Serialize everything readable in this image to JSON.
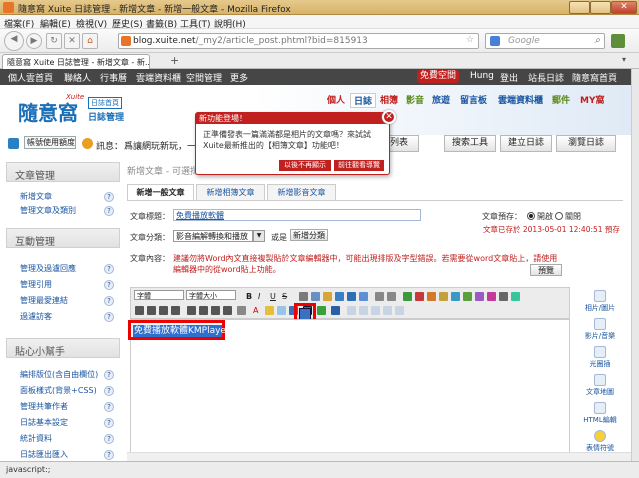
{
  "window": {
    "title": "隨意窩 Xuite 日誌管理 - 新增文章 - 新增一般文章 - Mozilla Firefox",
    "minimize": "",
    "maximize": "",
    "close": "✕"
  },
  "menu": [
    "檔案(F)",
    "編輯(E)",
    "檢視(V)",
    "歷史(S)",
    "書籤(B)",
    "工具(T)",
    "說明(H)"
  ],
  "nav": {
    "url_host": "blog.xuite.net",
    "url_path": "/_my2/article_post.phtml?bid=815913",
    "search_placeholder": "Google"
  },
  "browser_tab": {
    "label": "隨意窩 Xuite 日誌管理 - 新增文章 - 新...",
    "new_tab": "+"
  },
  "site_nav": {
    "items": [
      "個人雲首頁",
      "聯絡人",
      "行事曆",
      "雲端資料櫃",
      "空間管理",
      "更多"
    ],
    "free_space": "免費空間",
    "user": "Hung",
    "links": [
      "登出",
      "站長日誌",
      "隨意窩首頁"
    ]
  },
  "header": {
    "logo": "隨意窩",
    "logo_small": "Xuite",
    "home_badge": "日誌首頁",
    "product": "日誌管理",
    "tabs": [
      "個人",
      "日誌",
      "相簿",
      "影音",
      "旅遊",
      "留言板",
      "雲端資料櫃",
      "郵件",
      "MY窩"
    ]
  },
  "toolrow": {
    "account": "帳號使用額度",
    "message_label": "訊息：",
    "message": "爲讓網玩新玩，一日輕鬆",
    "buttons": [
      "日誌列表",
      "搜索工具",
      "建立日誌",
      "瀏覽日誌"
    ]
  },
  "popup": {
    "title": "新功能登場！",
    "body": "正準備發表一篇滿滿都是相片的文章嗎？來試試Xuite最新推出的【相簿文章】功能吧！",
    "btn_dismiss": "以後不再顯示",
    "btn_try": "前往觀看導覽",
    "close": "✕"
  },
  "sidebar": {
    "sections": [
      {
        "title": "文章管理",
        "items": [
          "新增文章",
          "管理文章及類別"
        ]
      },
      {
        "title": "互動管理",
        "items": [
          "管理及過瀘回應",
          "管理引用",
          "管理最愛連結",
          "過濾訪客"
        ]
      },
      {
        "title": "貼心小幫手",
        "items": [
          "編排版位(含自由欄位)",
          "面板樣式(背景+CSS)",
          "管理共筆作者",
          "日誌基本設定",
          "統計資料",
          "日誌匯出匯入"
        ]
      }
    ],
    "help": "?"
  },
  "main": {
    "breadcrumb": "新增文章 - 可選擇新增一般文章、相簿文章及影音文章",
    "tabs": [
      "新增一般文章",
      "新增相簿文章",
      "新增影音文章"
    ],
    "title_label": "文章標題：",
    "title_value": "免費播放軟體",
    "category_label": "文章分類：",
    "category_value": "影音編解轉換和播放",
    "or_label": "或是",
    "new_category": "新增分類",
    "preview_label": "文章預存：",
    "opt_on": "開啟",
    "opt_off": "關閉",
    "autosave": "文章已存於 2013-05-01 12:40:51 預存",
    "content_label": "文章內容：",
    "warning": "建議勿將Word內文直接複製貼於文章編輯器中，可能出現排版及字型錯誤。若需要從word文章貼上，請使用編輯器中的從word貼上功能。",
    "preview_btn": "預覽",
    "font_select": "字體",
    "size_select": "字體大小",
    "selected_text": "免費播放軟體KMPlayer",
    "side_tools": [
      "相片/圖片",
      "影片/音樂",
      "光圈插",
      "文章地圖",
      "HTML編輯",
      "表情符號"
    ]
  },
  "status": "javascript:;"
}
